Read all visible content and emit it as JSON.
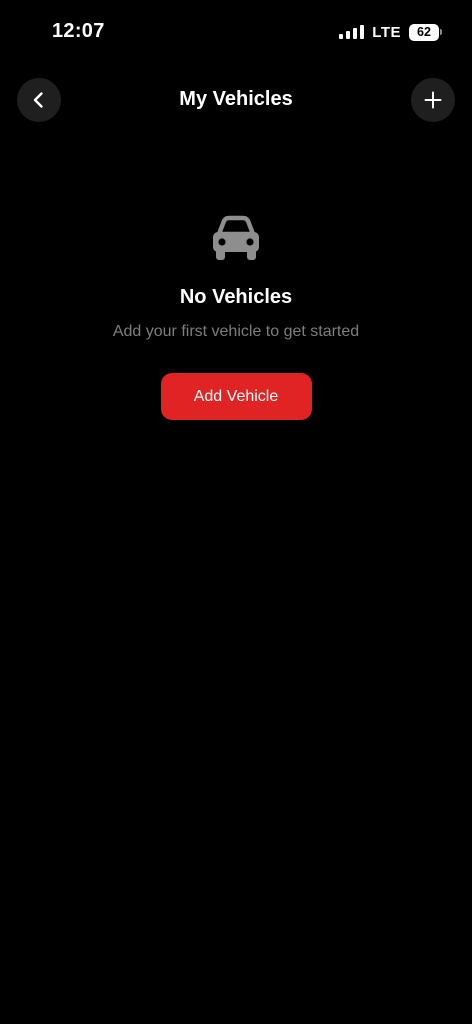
{
  "status_bar": {
    "time": "12:07",
    "network": "LTE",
    "battery_level": "62"
  },
  "nav": {
    "title": "My Vehicles",
    "back_icon": "chevron-left-icon",
    "add_icon": "plus-icon"
  },
  "empty_state": {
    "icon": "car-icon",
    "title": "No Vehicles",
    "subtitle": "Add your first vehicle to get started",
    "button_label": "Add Vehicle"
  },
  "colors": {
    "background": "#000000",
    "accent": "#e02424",
    "muted_text": "#7d7d7d",
    "icon_gray": "#8e8e8e",
    "nav_button_bg": "#1f1f1f"
  }
}
